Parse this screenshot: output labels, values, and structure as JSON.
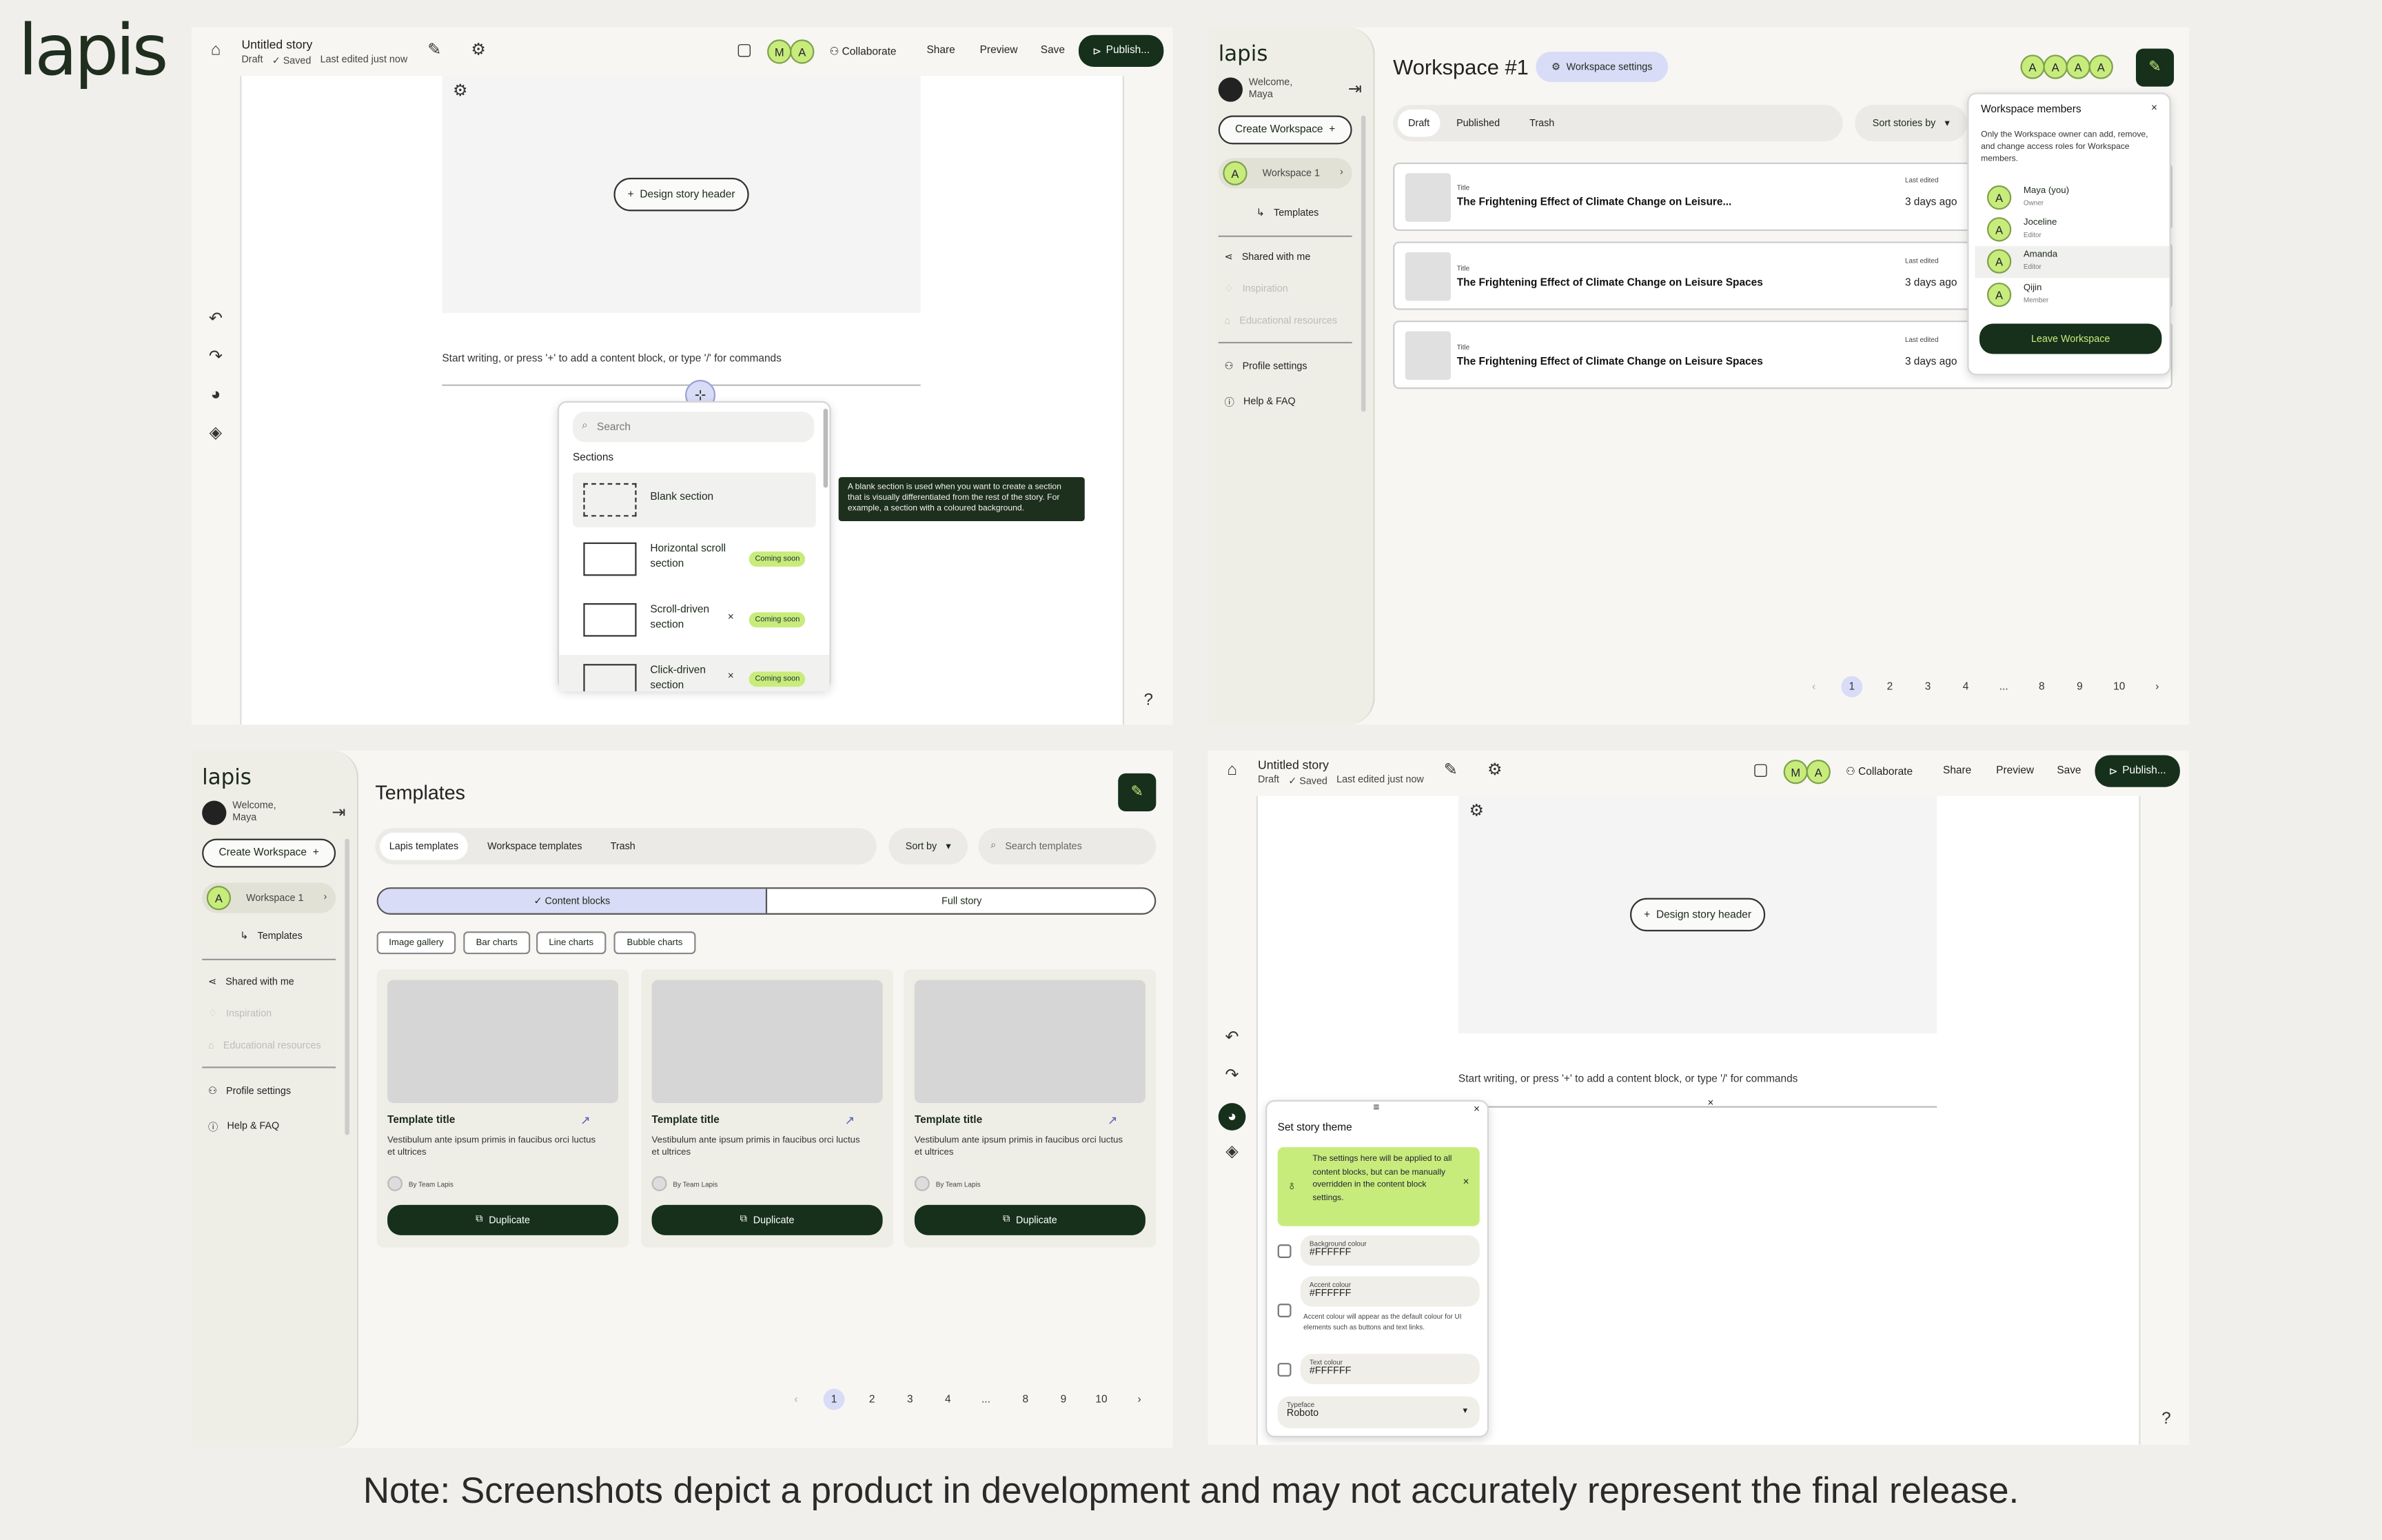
{
  "brand": {
    "logo_text": "lapis",
    "small_logo_text": "lapis"
  },
  "footer_note": "Note: Screenshots depict a product in development and may not accurately represent the final release.",
  "editor": {
    "story_title": "Untitled story",
    "status_draft": "Draft",
    "status_saved": "✓ Saved",
    "status_edited": "Last edited just now",
    "avatars": [
      "M",
      "A"
    ],
    "collaborate": "Collaborate",
    "share": "Share",
    "preview": "Preview",
    "save": "Save",
    "publish": "Publish...",
    "design_header_btn": "Design story header",
    "placeholder": "Start writing, or press '+' to add a content block, or type '/' for commands"
  },
  "block_menu": {
    "search_placeholder": "Search",
    "section_heading": "Sections",
    "items": [
      {
        "label1": "Blank section",
        "label2": "",
        "badge": ""
      },
      {
        "label1": "Horizontal scroll",
        "label2": "section",
        "badge": "Coming soon"
      },
      {
        "label1": "Scroll-driven",
        "label2": "section",
        "badge": "Coming soon"
      },
      {
        "label1": "Click-driven",
        "label2": "section",
        "badge": "Coming soon"
      }
    ],
    "tooltip": "A blank section is used when you want to create a section that is visually differentiated from the rest of the story. For example, a section with a coloured background."
  },
  "sidebar": {
    "welcome_line1": "Welcome,",
    "welcome_line2": "Maya",
    "create_workspace": "Create Workspace",
    "workspace_name": "Workspace 1",
    "workspace_avatar": "A",
    "templates": "Templates",
    "items": [
      "Shared with me",
      "Inspiration",
      "Educational resources",
      "Profile settings",
      "Help & FAQ"
    ]
  },
  "workspace": {
    "title": "Workspace #1",
    "settings_btn": "Workspace settings",
    "member_avatars": [
      "A",
      "A",
      "A",
      "A"
    ],
    "tabs": [
      "Draft",
      "Published",
      "Trash"
    ],
    "sort": "Sort stories by",
    "rows": [
      {
        "title_label": "Title",
        "title": "The Frightening Effect of Climate Change on Leisure...",
        "edited_label": "Last edited",
        "edited": "3 days ago"
      },
      {
        "title_label": "Title",
        "title": "The Frightening Effect of Climate Change on Leisure Spaces",
        "edited_label": "Last edited",
        "edited": "3 days ago"
      },
      {
        "title_label": "Title",
        "title": "The Frightening Effect of Climate Change on Leisure Spaces",
        "edited_label": "Last edited",
        "edited": "3 days ago"
      }
    ],
    "members_popup": {
      "title": "Workspace members",
      "desc": "Only the Workspace owner can add, remove, and change access roles for Workspace members.",
      "members": [
        {
          "name": "Maya (you)",
          "role": "Owner",
          "avatar": "A"
        },
        {
          "name": "Joceline",
          "role": "Editor",
          "avatar": "A"
        },
        {
          "name": "Amanda",
          "role": "Editor",
          "avatar": "A"
        },
        {
          "name": "Qijin",
          "role": "Member",
          "avatar": "A"
        }
      ],
      "leave": "Leave Workspace"
    }
  },
  "pagination": [
    "‹",
    "1",
    "2",
    "3",
    "4",
    "...",
    "8",
    "9",
    "10",
    "›"
  ],
  "templates": {
    "title": "Templates",
    "tabs": [
      "Lapis templates",
      "Workspace templates",
      "Trash"
    ],
    "sort": "Sort by",
    "search_placeholder": "Search templates",
    "toggle": [
      "✓ Content blocks",
      "Full story"
    ],
    "chips": [
      "Image gallery",
      "Bar charts",
      "Line charts",
      "Bubble charts"
    ],
    "cards": [
      {
        "title": "Template title",
        "desc": "Vestibulum ante ipsum primis in faucibus orci luctus et ultrices",
        "author": "By Team Lapis",
        "action": "Duplicate"
      },
      {
        "title": "Template title",
        "desc": "Vestibulum ante ipsum primis in faucibus orci luctus et ultrices",
        "author": "By Team Lapis",
        "action": "Duplicate"
      },
      {
        "title": "Template title",
        "desc": "Vestibulum ante ipsum primis in faucibus orci luctus et ultrices",
        "author": "By Team Lapis",
        "action": "Duplicate"
      }
    ]
  },
  "theme_panel": {
    "title": "Set story theme",
    "info": "The settings here will be applied to all content blocks, but can be manually overridden in the content block settings.",
    "bg_label": "Background colour",
    "bg_value": "#FFFFFF",
    "accent_label": "Accent colour",
    "accent_value": "#FFFFFF",
    "accent_help": "Accent colour will appear as the default colour for UI elements such as buttons and text links.",
    "text_label": "Text colour",
    "text_value": "#FFFFFF",
    "typeface_label": "Typeface",
    "typeface_value": "Roboto"
  },
  "colors": {
    "accent_green": "#c8ec7c",
    "dark_green": "#16301b",
    "page_highlight": "#d9dcf7"
  }
}
